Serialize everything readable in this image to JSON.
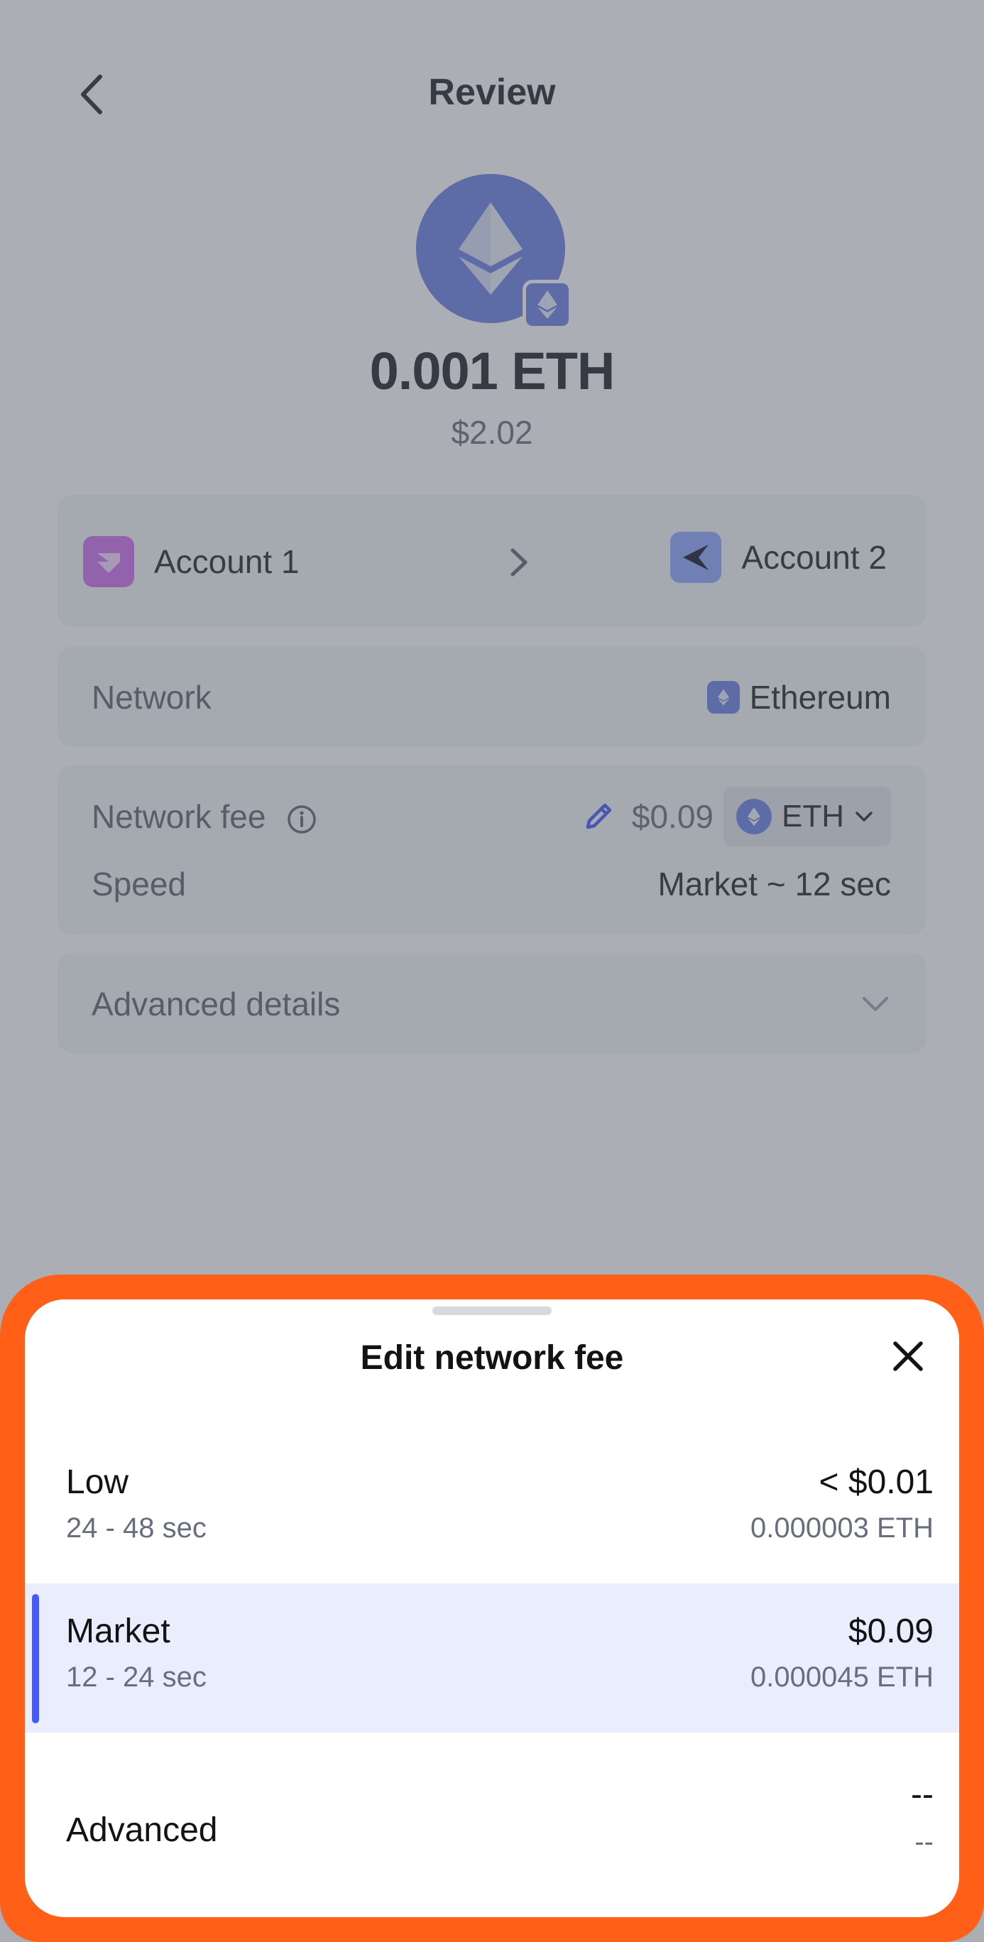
{
  "header": {
    "title": "Review"
  },
  "transfer": {
    "amount": "0.001 ETH",
    "fiat": "$2.02",
    "from_account": "Account 1",
    "to_account": "Account 2"
  },
  "network": {
    "label": "Network",
    "value": "Ethereum"
  },
  "fee": {
    "label": "Network fee",
    "amount": "$0.09",
    "token": "ETH",
    "speed_label": "Speed",
    "speed_value": "Market ~ 12 sec"
  },
  "advanced_details": {
    "label": "Advanced details"
  },
  "sheet": {
    "title": "Edit network fee",
    "options": [
      {
        "name": "Low",
        "time": "24 - 48 sec",
        "fiat": "< $0.01",
        "crypto": "0.000003 ETH",
        "selected": false
      },
      {
        "name": "Market",
        "time": "12 - 24 sec",
        "fiat": "$0.09",
        "crypto": "0.000045 ETH",
        "selected": true
      },
      {
        "name": "Advanced",
        "time": "",
        "fiat": "--",
        "crypto": "--",
        "selected": false
      }
    ]
  },
  "colors": {
    "accent": "#4459ff",
    "eth": "#6a80e4",
    "highlight_outline": "#ff5f16",
    "selected_row": "#eaedfc"
  },
  "icons": {
    "back": "back-arrow-icon",
    "token": "ethereum-icon",
    "close": "close-icon",
    "edit": "pencil-icon",
    "info": "info-icon",
    "expand": "chevron-down-icon"
  }
}
